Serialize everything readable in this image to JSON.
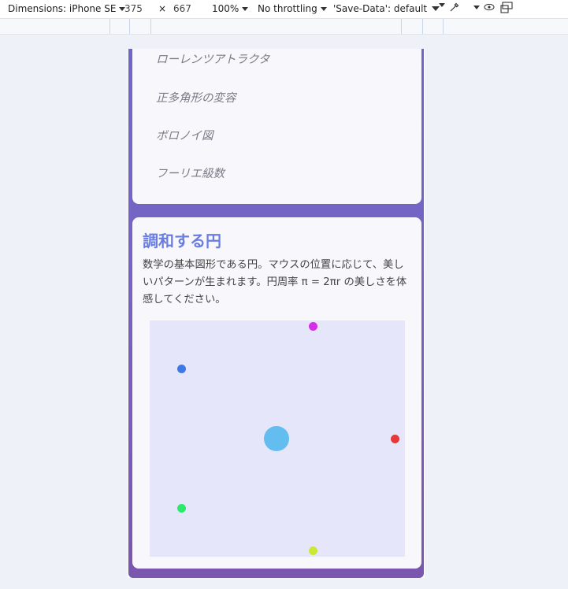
{
  "devtools": {
    "device_label": "Dimensions: iPhone SE",
    "width": "375",
    "times": "×",
    "height": "667",
    "zoom": "100%",
    "throttling": "No throttling",
    "save_data": "'Save-Data': default"
  },
  "menu": {
    "items": [
      {
        "label": "ローレンツアトラクタ"
      },
      {
        "label": "正多角形の変容"
      },
      {
        "label": "ボロノイ図"
      },
      {
        "label": "フーリエ級数"
      }
    ]
  },
  "section": {
    "title": "調和する円",
    "description": "数学の基本図形である円。マウスの位置に応じて、美しいパターンが生まれます。円周率 π = 2πr の美しさを体感してください。"
  },
  "canvas": {
    "dots": [
      {
        "name": "dot-magenta",
        "color": "#d52ee8"
      },
      {
        "name": "dot-blue",
        "color": "#3b7ae8"
      },
      {
        "name": "dot-red",
        "color": "#e8373b"
      },
      {
        "name": "dot-center",
        "color": "#63bdef"
      },
      {
        "name": "dot-green",
        "color": "#2ee86e"
      },
      {
        "name": "dot-yellow",
        "color": "#cbe837"
      }
    ]
  },
  "colors": {
    "accent": "#6a7de0",
    "canvas_bg": "#e6e6fb"
  }
}
